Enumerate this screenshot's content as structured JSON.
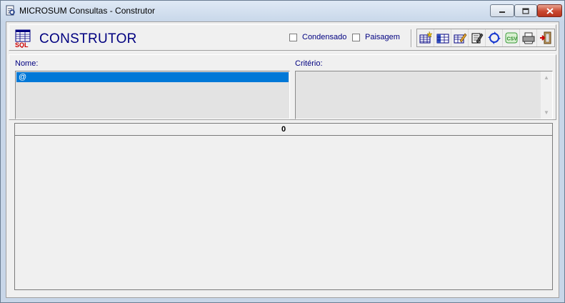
{
  "window": {
    "title": "MICROSUM Consultas - Construtor"
  },
  "header": {
    "title": "CONSTRUTOR",
    "logo_text": "SQL",
    "options": [
      {
        "label": "Condensado",
        "checked": false
      },
      {
        "label": "Paisagem",
        "checked": false
      }
    ],
    "toolbar_icons": [
      "new-query-icon",
      "columns-icon",
      "edit-icon",
      "edit-sql-icon",
      "refresh-icon",
      "csv-export-icon",
      "print-icon",
      "exit-icon"
    ]
  },
  "filters": {
    "nome_label": "Nome:",
    "nome_items": [
      "@"
    ],
    "criterio_label": "Critério:"
  },
  "grid": {
    "header_value": "0"
  }
}
